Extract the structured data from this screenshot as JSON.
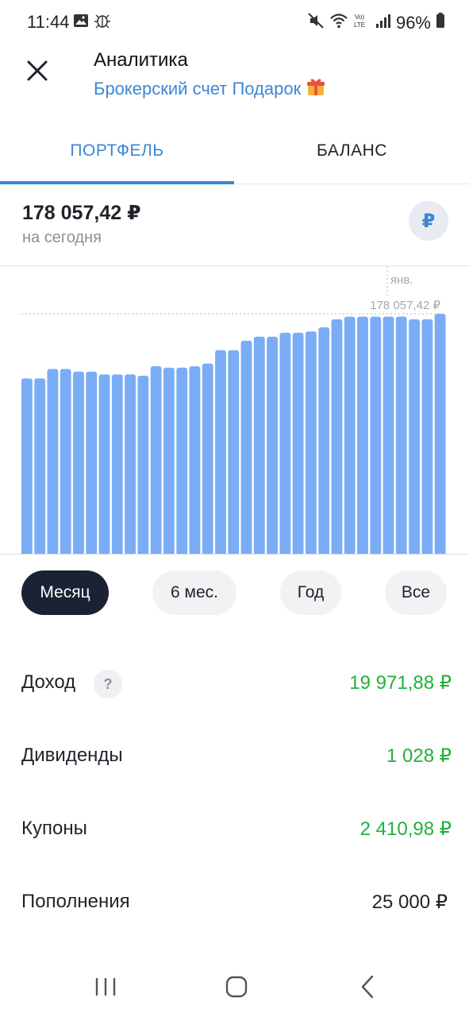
{
  "status_bar": {
    "time": "11:44",
    "battery": "96%",
    "icons": [
      "image-icon",
      "bug-icon",
      "mute-icon",
      "wifi-icon",
      "volte-icon",
      "signal-icon",
      "battery-icon"
    ]
  },
  "header": {
    "title": "Аналитика",
    "subtitle": "Брокерский счет Подарок",
    "subtitle_icon": "gift-icon"
  },
  "tabs": [
    {
      "label": "ПОРТФЕЛЬ",
      "active": true
    },
    {
      "label": "БАЛАНС",
      "active": false
    }
  ],
  "total": {
    "value": "178 057,42 ₽",
    "caption": "на сегодня",
    "currency_button": "₽"
  },
  "chart_data": {
    "type": "bar",
    "marker_label": "янв.",
    "current_label": "178 057,42 ₽",
    "current_value": 178057.42,
    "ylim": [
      0,
      178057.42
    ],
    "values": [
      130000,
      130000,
      137000,
      137000,
      135000,
      135000,
      133000,
      133000,
      133000,
      132000,
      139000,
      138000,
      138000,
      139000,
      141000,
      151000,
      151000,
      158000,
      161000,
      161000,
      164000,
      164000,
      165000,
      168000,
      174000,
      176000,
      176000,
      176000,
      176000,
      176000,
      174000,
      174000,
      178057.42
    ],
    "color": "#7aadf5"
  },
  "periods": [
    {
      "label": "Месяц",
      "active": true
    },
    {
      "label": "6 мес.",
      "active": false
    },
    {
      "label": "Год",
      "active": false
    },
    {
      "label": "Все",
      "active": false
    }
  ],
  "stats": {
    "income": {
      "label": "Доход",
      "help": "?",
      "value": "19 971,88 ₽"
    },
    "dividends": {
      "label": "Дивиденды",
      "value": "1 028 ₽"
    },
    "coupons": {
      "label": "Купоны",
      "value": "2 410,98 ₽"
    },
    "deposits": {
      "label": "Пополнения",
      "value": "25 000 ₽"
    }
  },
  "colors": {
    "accent": "#3b86d9",
    "positive": "#22b03a",
    "active_button": "#1a2233",
    "bar": "#7aadf5"
  }
}
